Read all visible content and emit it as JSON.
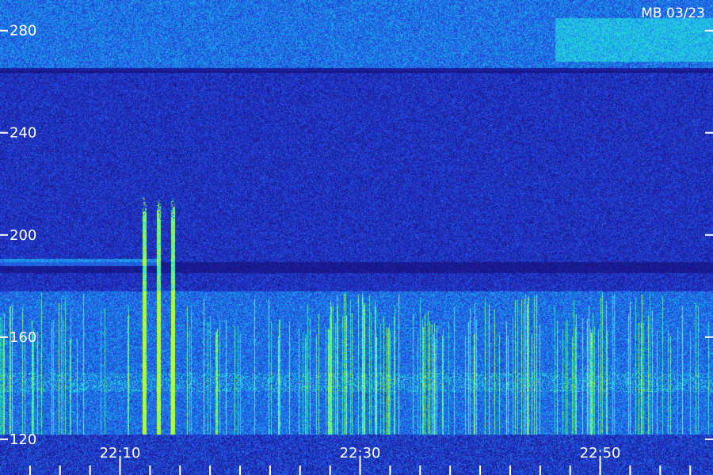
{
  "chart_data": {
    "type": "heatmap",
    "title": "MB 03/23",
    "xlabel": "",
    "ylabel": "",
    "x_ticks": [
      "22:10",
      "22:30",
      "22:50"
    ],
    "y_ticks": [
      120,
      160,
      200,
      240,
      280
    ],
    "ylim": [
      106,
      292
    ],
    "xlim_minutes": [
      22.0,
      22.99
    ],
    "colormap": [
      "#140a6a",
      "#2438d8",
      "#1aa8f0",
      "#30f0c8",
      "#b8ff30"
    ],
    "features": [
      {
        "name": "bright vertical bursts",
        "x_minutes": [
          22.2,
          22.22,
          22.24
        ],
        "y_range": [
          110,
          215
        ]
      },
      {
        "name": "activity band",
        "y_range": [
          110,
          178
        ]
      },
      {
        "name": "horizontal band",
        "y_range": [
          268,
          285
        ]
      }
    ]
  }
}
